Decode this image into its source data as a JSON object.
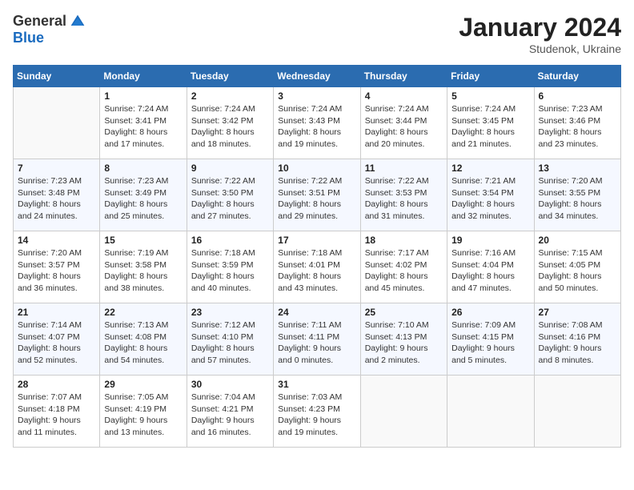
{
  "header": {
    "logo_general": "General",
    "logo_blue": "Blue",
    "month_title": "January 2024",
    "subtitle": "Studenok, Ukraine"
  },
  "days_of_week": [
    "Sunday",
    "Monday",
    "Tuesday",
    "Wednesday",
    "Thursday",
    "Friday",
    "Saturday"
  ],
  "weeks": [
    [
      {
        "day": "",
        "info": ""
      },
      {
        "day": "1",
        "info": "Sunrise: 7:24 AM\nSunset: 3:41 PM\nDaylight: 8 hours\nand 17 minutes."
      },
      {
        "day": "2",
        "info": "Sunrise: 7:24 AM\nSunset: 3:42 PM\nDaylight: 8 hours\nand 18 minutes."
      },
      {
        "day": "3",
        "info": "Sunrise: 7:24 AM\nSunset: 3:43 PM\nDaylight: 8 hours\nand 19 minutes."
      },
      {
        "day": "4",
        "info": "Sunrise: 7:24 AM\nSunset: 3:44 PM\nDaylight: 8 hours\nand 20 minutes."
      },
      {
        "day": "5",
        "info": "Sunrise: 7:24 AM\nSunset: 3:45 PM\nDaylight: 8 hours\nand 21 minutes."
      },
      {
        "day": "6",
        "info": "Sunrise: 7:23 AM\nSunset: 3:46 PM\nDaylight: 8 hours\nand 23 minutes."
      }
    ],
    [
      {
        "day": "7",
        "info": "Sunrise: 7:23 AM\nSunset: 3:48 PM\nDaylight: 8 hours\nand 24 minutes."
      },
      {
        "day": "8",
        "info": "Sunrise: 7:23 AM\nSunset: 3:49 PM\nDaylight: 8 hours\nand 25 minutes."
      },
      {
        "day": "9",
        "info": "Sunrise: 7:22 AM\nSunset: 3:50 PM\nDaylight: 8 hours\nand 27 minutes."
      },
      {
        "day": "10",
        "info": "Sunrise: 7:22 AM\nSunset: 3:51 PM\nDaylight: 8 hours\nand 29 minutes."
      },
      {
        "day": "11",
        "info": "Sunrise: 7:22 AM\nSunset: 3:53 PM\nDaylight: 8 hours\nand 31 minutes."
      },
      {
        "day": "12",
        "info": "Sunrise: 7:21 AM\nSunset: 3:54 PM\nDaylight: 8 hours\nand 32 minutes."
      },
      {
        "day": "13",
        "info": "Sunrise: 7:20 AM\nSunset: 3:55 PM\nDaylight: 8 hours\nand 34 minutes."
      }
    ],
    [
      {
        "day": "14",
        "info": "Sunrise: 7:20 AM\nSunset: 3:57 PM\nDaylight: 8 hours\nand 36 minutes."
      },
      {
        "day": "15",
        "info": "Sunrise: 7:19 AM\nSunset: 3:58 PM\nDaylight: 8 hours\nand 38 minutes."
      },
      {
        "day": "16",
        "info": "Sunrise: 7:18 AM\nSunset: 3:59 PM\nDaylight: 8 hours\nand 40 minutes."
      },
      {
        "day": "17",
        "info": "Sunrise: 7:18 AM\nSunset: 4:01 PM\nDaylight: 8 hours\nand 43 minutes."
      },
      {
        "day": "18",
        "info": "Sunrise: 7:17 AM\nSunset: 4:02 PM\nDaylight: 8 hours\nand 45 minutes."
      },
      {
        "day": "19",
        "info": "Sunrise: 7:16 AM\nSunset: 4:04 PM\nDaylight: 8 hours\nand 47 minutes."
      },
      {
        "day": "20",
        "info": "Sunrise: 7:15 AM\nSunset: 4:05 PM\nDaylight: 8 hours\nand 50 minutes."
      }
    ],
    [
      {
        "day": "21",
        "info": "Sunrise: 7:14 AM\nSunset: 4:07 PM\nDaylight: 8 hours\nand 52 minutes."
      },
      {
        "day": "22",
        "info": "Sunrise: 7:13 AM\nSunset: 4:08 PM\nDaylight: 8 hours\nand 54 minutes."
      },
      {
        "day": "23",
        "info": "Sunrise: 7:12 AM\nSunset: 4:10 PM\nDaylight: 8 hours\nand 57 minutes."
      },
      {
        "day": "24",
        "info": "Sunrise: 7:11 AM\nSunset: 4:11 PM\nDaylight: 9 hours\nand 0 minutes."
      },
      {
        "day": "25",
        "info": "Sunrise: 7:10 AM\nSunset: 4:13 PM\nDaylight: 9 hours\nand 2 minutes."
      },
      {
        "day": "26",
        "info": "Sunrise: 7:09 AM\nSunset: 4:15 PM\nDaylight: 9 hours\nand 5 minutes."
      },
      {
        "day": "27",
        "info": "Sunrise: 7:08 AM\nSunset: 4:16 PM\nDaylight: 9 hours\nand 8 minutes."
      }
    ],
    [
      {
        "day": "28",
        "info": "Sunrise: 7:07 AM\nSunset: 4:18 PM\nDaylight: 9 hours\nand 11 minutes."
      },
      {
        "day": "29",
        "info": "Sunrise: 7:05 AM\nSunset: 4:19 PM\nDaylight: 9 hours\nand 13 minutes."
      },
      {
        "day": "30",
        "info": "Sunrise: 7:04 AM\nSunset: 4:21 PM\nDaylight: 9 hours\nand 16 minutes."
      },
      {
        "day": "31",
        "info": "Sunrise: 7:03 AM\nSunset: 4:23 PM\nDaylight: 9 hours\nand 19 minutes."
      },
      {
        "day": "",
        "info": ""
      },
      {
        "day": "",
        "info": ""
      },
      {
        "day": "",
        "info": ""
      }
    ]
  ]
}
